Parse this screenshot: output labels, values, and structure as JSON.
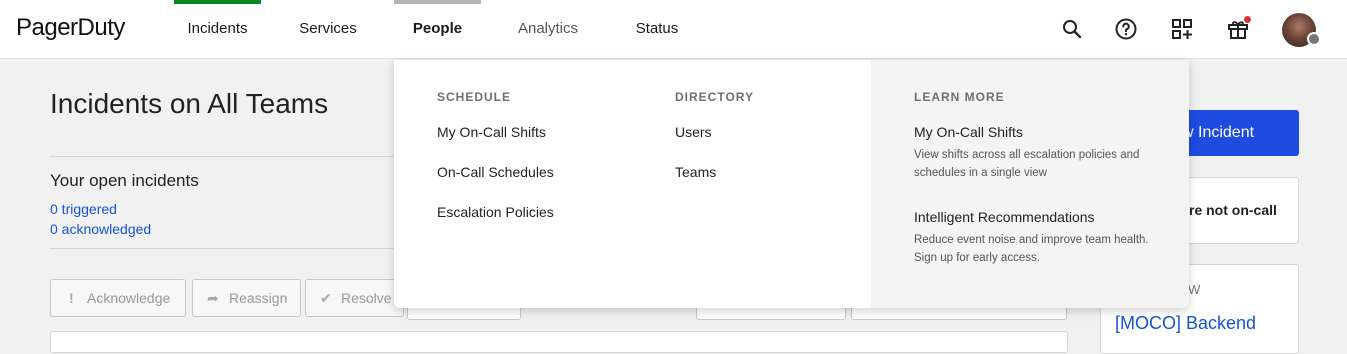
{
  "brand": {
    "logo_text": "PagerDuty"
  },
  "nav": {
    "items": [
      {
        "label": "Incidents",
        "state": "active-green",
        "color": "#048a24"
      },
      {
        "label": "Services"
      },
      {
        "label": "People",
        "state": "open",
        "color": "#b5b5b5"
      },
      {
        "label": "Analytics"
      },
      {
        "label": "Status"
      }
    ],
    "icons": [
      "search-icon",
      "help-icon",
      "apps-add-icon",
      "gift-icon",
      "user-avatar"
    ]
  },
  "page": {
    "title": "Incidents on All Teams",
    "open_incidents_title": "Your open incidents",
    "triggered": "0 triggered",
    "acknowledged": "0 acknowledged"
  },
  "actions": {
    "acknowledge": "Acknowledge",
    "reassign": "Reassign",
    "resolve": "Resolve"
  },
  "sidebar": {
    "new_incident": "w Incident",
    "oncall_status": "re not on-call",
    "section_label": "W",
    "service_link": "[MOCO] Backend"
  },
  "dropdown": {
    "schedule": {
      "heading": "SCHEDULE",
      "links": [
        "My On-Call Shifts",
        "On-Call Schedules",
        "Escalation Policies"
      ]
    },
    "directory": {
      "heading": "DIRECTORY",
      "links": [
        "Users",
        "Teams"
      ]
    },
    "learn_more": {
      "heading": "LEARN MORE",
      "items": [
        {
          "title": "My On-Call Shifts",
          "desc": "View shifts across all escalation policies and schedules in a single view"
        },
        {
          "title": "Intelligent Recommendations",
          "desc": "Reduce event noise and improve team health. Sign up for early access."
        }
      ]
    }
  },
  "colors": {
    "accent": "#1e4be0",
    "link": "#1154d5",
    "active_tab": "#048a24"
  }
}
